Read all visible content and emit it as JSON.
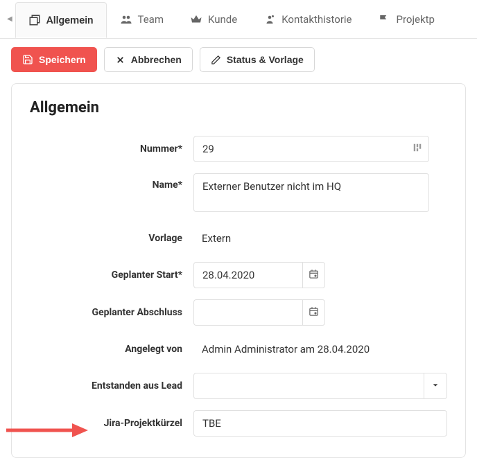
{
  "tabs": {
    "general": "Allgemein",
    "team": "Team",
    "customer": "Kunde",
    "contact_history": "Kontakthistorie",
    "project": "Projektp"
  },
  "actions": {
    "save": "Speichern",
    "cancel": "Abbrechen",
    "status_template": "Status & Vorlage"
  },
  "section": {
    "title": "Allgemein",
    "labels": {
      "number": "Nummer*",
      "name": "Name*",
      "template": "Vorlage",
      "planned_start": "Geplanter Start*",
      "planned_end": "Geplanter Abschluss",
      "created_by": "Angelegt von",
      "from_lead": "Entstanden aus Lead",
      "jira_key": "Jira-Projektkürzel"
    },
    "values": {
      "number": "29",
      "name": "Externer Benutzer nicht im HQ",
      "template": "Extern",
      "planned_start": "28.04.2020",
      "planned_end": "",
      "created_by": "Admin Administrator am 28.04.2020",
      "from_lead": "",
      "jira_key": "TBE"
    }
  }
}
